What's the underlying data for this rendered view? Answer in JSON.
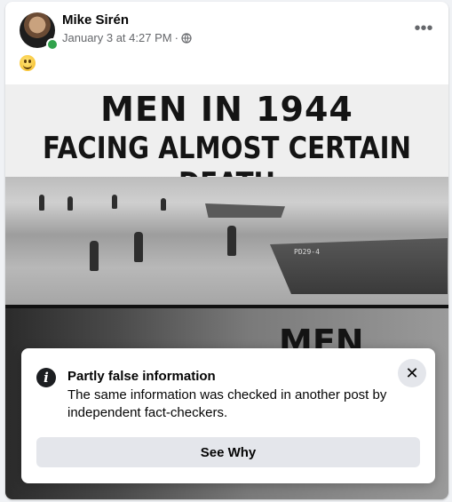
{
  "post": {
    "author": "Mike Sirén",
    "timestamp": "January 3 at 4:27 PM",
    "separator": "·",
    "privacy_icon": "globe-icon",
    "more_label": "•••",
    "text_emoji": "grinning-face-emoji"
  },
  "image": {
    "line1": "MEN IN 1944",
    "line2": "FACING ALMOST CERTAIN DEATH",
    "line3": "MEN",
    "boat_marking": "PD29-4"
  },
  "fact_check": {
    "title": "Partly false information",
    "body": "The same information was checked in another post by independent fact-checkers.",
    "button_label": "See Why",
    "close_label": "✕"
  },
  "colors": {
    "online": "#31a24c",
    "button_bg": "#e4e6eb",
    "secondary_text": "#65676b"
  }
}
